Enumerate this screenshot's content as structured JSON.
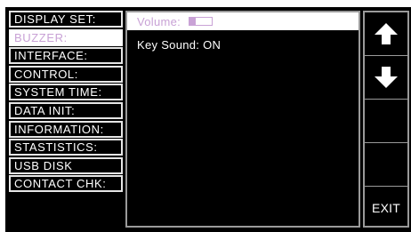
{
  "menu": {
    "items": [
      {
        "label": "DISPLAY SET:"
      },
      {
        "label": "BUZZER:",
        "selected": true
      },
      {
        "label": "INTERFACE:"
      },
      {
        "label": "CONTROL:"
      },
      {
        "label": "SYSTEM TIME:"
      },
      {
        "label": "DATA INIT:"
      },
      {
        "label": "INFORMATION:"
      },
      {
        "label": "STASTISTICS:"
      },
      {
        "label": "USB DISK"
      },
      {
        "label": "CONTACT CHK:"
      }
    ]
  },
  "buzzer": {
    "volume_label": "Volume:",
    "volume_level": 0.27,
    "key_sound_label": "Key Sound: ON"
  },
  "softkeys": {
    "up_icon": "arrow-up-icon",
    "down_icon": "arrow-down-icon",
    "exit_label": "EXIT"
  },
  "colors": {
    "background": "#000000",
    "selected_background": "#ffffff",
    "accent": "#c9a2d6",
    "text": "#ffffff",
    "border": "#9a9a9a"
  }
}
